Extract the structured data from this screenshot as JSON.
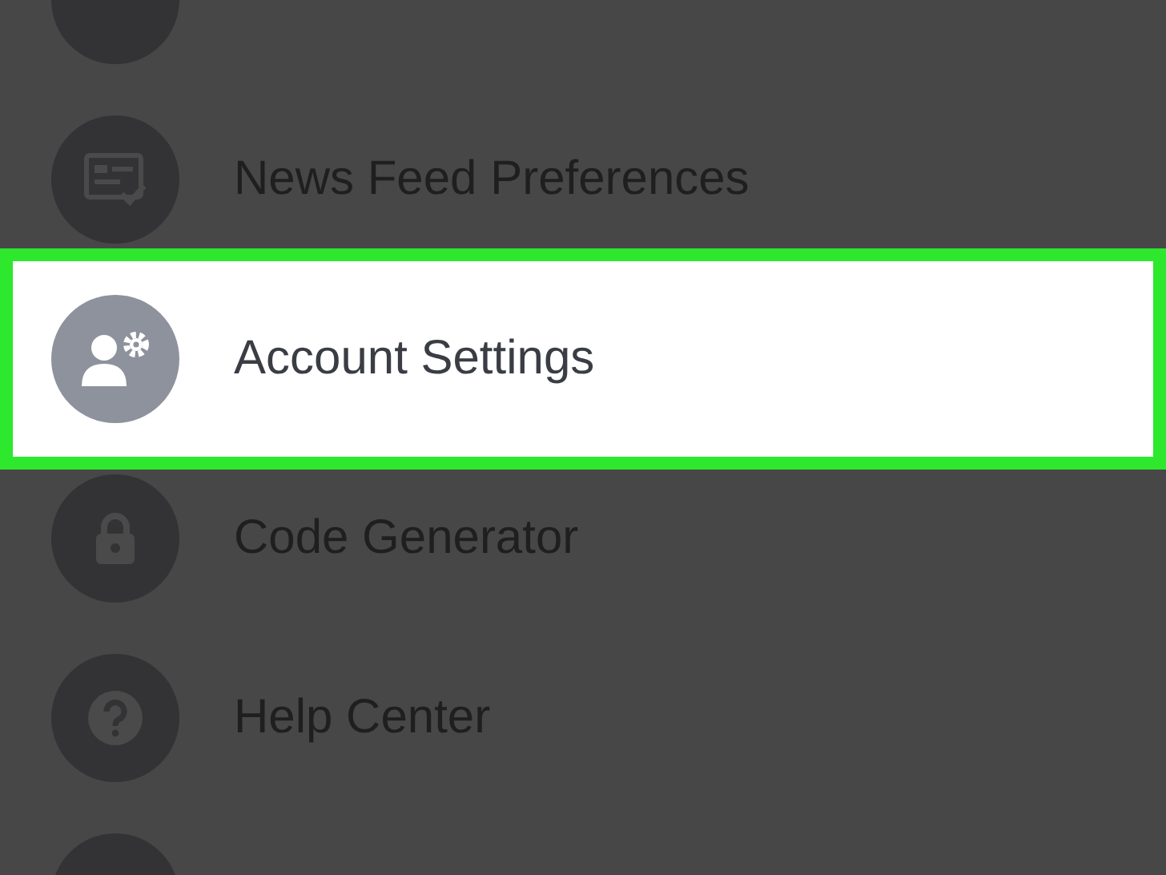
{
  "menu": {
    "items": [
      {
        "kind": "blank",
        "highlighted": false
      },
      {
        "kind": "news",
        "label": "News Feed Preferences",
        "highlighted": false
      },
      {
        "kind": "account",
        "label": "Account Settings",
        "highlighted": true
      },
      {
        "kind": "lock",
        "label": "Code Generator",
        "highlighted": false
      },
      {
        "kind": "help",
        "label": "Help Center",
        "highlighted": false
      },
      {
        "kind": "blank",
        "highlighted": false
      }
    ]
  }
}
